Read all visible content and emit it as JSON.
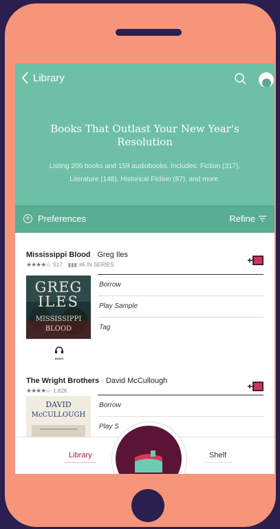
{
  "nav": {
    "back_label": "Library"
  },
  "list": {
    "title": "Books That Outlast Your New Year's Resolution",
    "description": "Listing 206 books and 159 audiobooks. Includes: Fiction (317), Literature (148), Historical Fiction (87), and more."
  },
  "filter": {
    "preferences_label": "Preferences",
    "refine_label": "Refine"
  },
  "books": [
    {
      "title": "Mississippi Blood",
      "author": "Greg Iles",
      "rating_count": "517",
      "series": "#6 IN SERIES",
      "cover_author_line1": "GREG",
      "cover_author_line2": "ILES",
      "cover_title_line1": "MISSISSIPPI",
      "cover_title_line2": "BLOOD",
      "format_label": "AUDIO",
      "actions": [
        "Borrow",
        "Play Sample",
        "Tag"
      ]
    },
    {
      "title": "The Wright Brothers",
      "author": "David McCullough",
      "rating_count": "1.82K",
      "cover_author_line1": "DAVID",
      "cover_author_line2": "McCULLOUGH",
      "actions": [
        "Borrow",
        "Play S"
      ]
    }
  ],
  "bottom_nav": {
    "library_label": "Library",
    "shelf_label": "Shelf"
  },
  "colors": {
    "header_teal": "#6dbfa6",
    "filter_teal": "#58ad92",
    "brand_maroon": "#5b1436",
    "accent_pink": "#b0174e",
    "phone_coral": "#f7957a",
    "background": "#2a1f4e"
  },
  "icons": [
    "chevron-left-icon",
    "search-icon",
    "avatar-icon",
    "plus-circle-icon",
    "filter-icon",
    "borrow-badge-icon",
    "headphones-icon",
    "book-icon"
  ]
}
